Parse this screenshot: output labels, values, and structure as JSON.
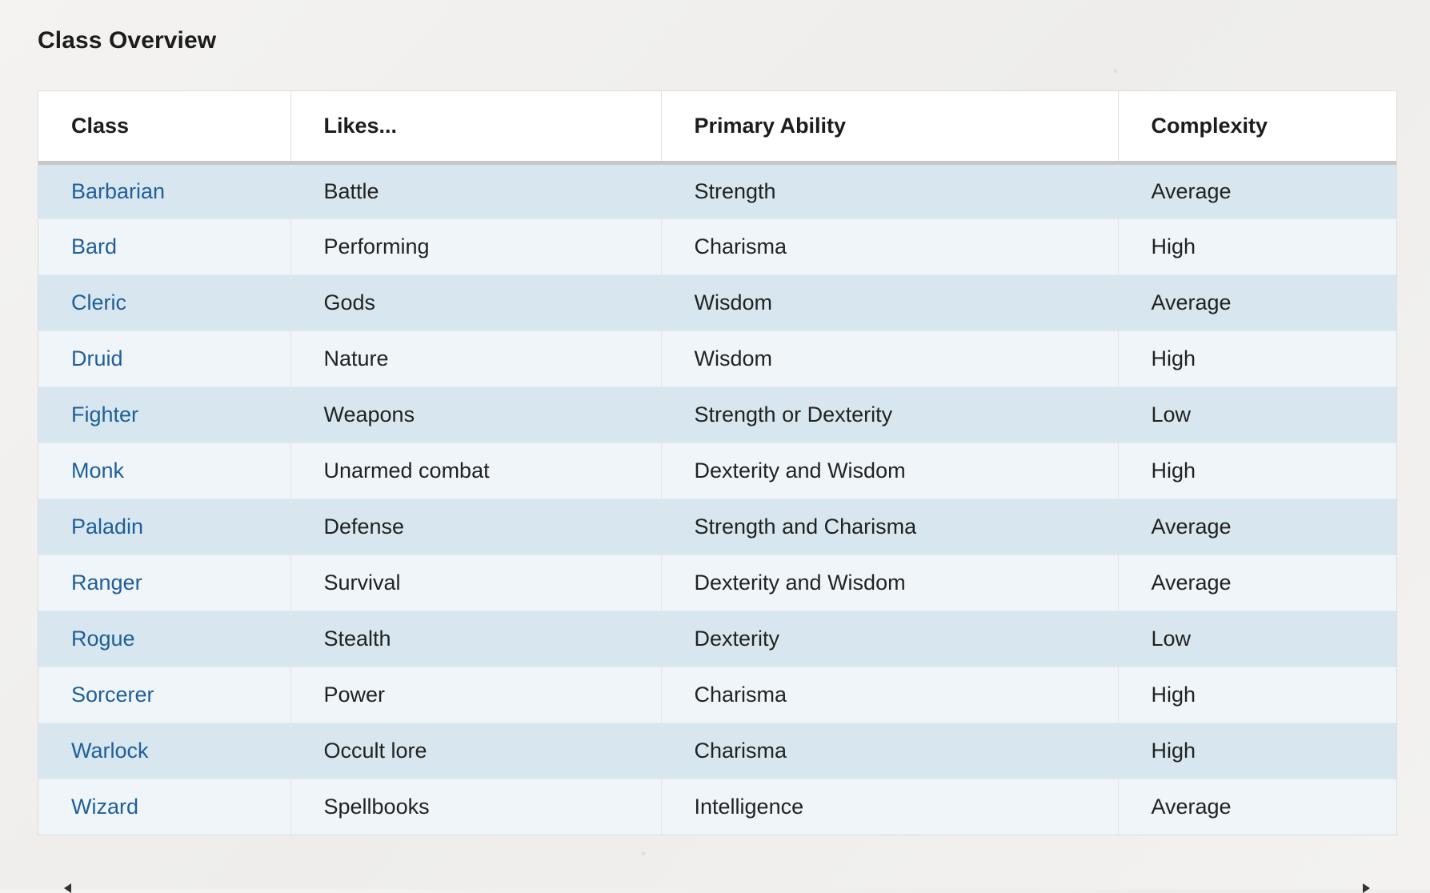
{
  "page": {
    "title": "Class Overview"
  },
  "table": {
    "headers": [
      "Class",
      "Likes...",
      "Primary Ability",
      "Complexity"
    ],
    "rows": [
      {
        "class": "Barbarian",
        "likes": "Battle",
        "primary_ability": "Strength",
        "complexity": "Average"
      },
      {
        "class": "Bard",
        "likes": "Performing",
        "primary_ability": "Charisma",
        "complexity": "High"
      },
      {
        "class": "Cleric",
        "likes": "Gods",
        "primary_ability": "Wisdom",
        "complexity": "Average"
      },
      {
        "class": "Druid",
        "likes": "Nature",
        "primary_ability": "Wisdom",
        "complexity": "High"
      },
      {
        "class": "Fighter",
        "likes": "Weapons",
        "primary_ability": "Strength or Dexterity",
        "complexity": "Low"
      },
      {
        "class": "Monk",
        "likes": "Unarmed combat",
        "primary_ability": "Dexterity and Wisdom",
        "complexity": "High"
      },
      {
        "class": "Paladin",
        "likes": "Defense",
        "primary_ability": "Strength and Charisma",
        "complexity": "Average"
      },
      {
        "class": "Ranger",
        "likes": "Survival",
        "primary_ability": "Dexterity and Wisdom",
        "complexity": "Average"
      },
      {
        "class": "Rogue",
        "likes": "Stealth",
        "primary_ability": "Dexterity",
        "complexity": "Low"
      },
      {
        "class": "Sorcerer",
        "likes": "Power",
        "primary_ability": "Charisma",
        "complexity": "High"
      },
      {
        "class": "Warlock",
        "likes": "Occult lore",
        "primary_ability": "Charisma",
        "complexity": "High"
      },
      {
        "class": "Wizard",
        "likes": "Spellbooks",
        "primary_ability": "Intelligence",
        "complexity": "Average"
      }
    ]
  },
  "colors": {
    "link": "#1f5f99",
    "row_odd": "#d8e7ef",
    "row_even": "#eff5f9",
    "header_rule": "#c9c7c4"
  },
  "icons": {
    "scroll_left": "chevron-left-icon",
    "scroll_right": "chevron-right-icon"
  }
}
